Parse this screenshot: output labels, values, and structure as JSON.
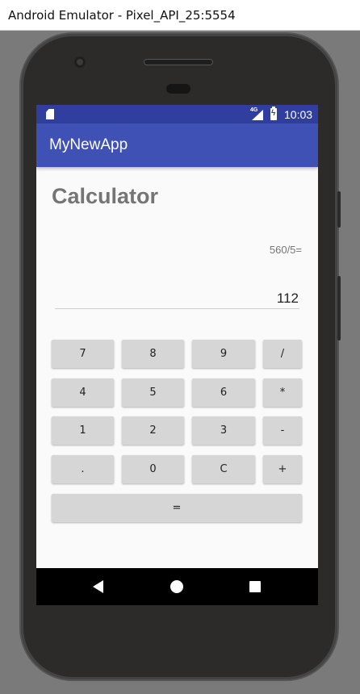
{
  "window": {
    "title": "Android Emulator - Pixel_API_25:5554"
  },
  "statusbar": {
    "time": "10:03",
    "network": "4G",
    "icons": [
      "sd-card-icon",
      "signal-icon",
      "battery-charging-icon"
    ]
  },
  "appbar": {
    "title": "MyNewApp"
  },
  "calculator": {
    "heading": "Calculator",
    "expression": "560/5=",
    "result": "112",
    "keys": [
      [
        "7",
        "8",
        "9",
        "/"
      ],
      [
        "4",
        "5",
        "6",
        "*"
      ],
      [
        "1",
        "2",
        "3",
        "-"
      ],
      [
        ".",
        "0",
        "C",
        "+"
      ],
      [
        "="
      ]
    ]
  },
  "navbar": {
    "icons": [
      "back-icon",
      "home-icon",
      "recents-icon"
    ]
  },
  "colors": {
    "statusbar": "#303f9f",
    "appbar": "#3f51b5",
    "key": "#d6d6d6",
    "heading": "#757575"
  }
}
